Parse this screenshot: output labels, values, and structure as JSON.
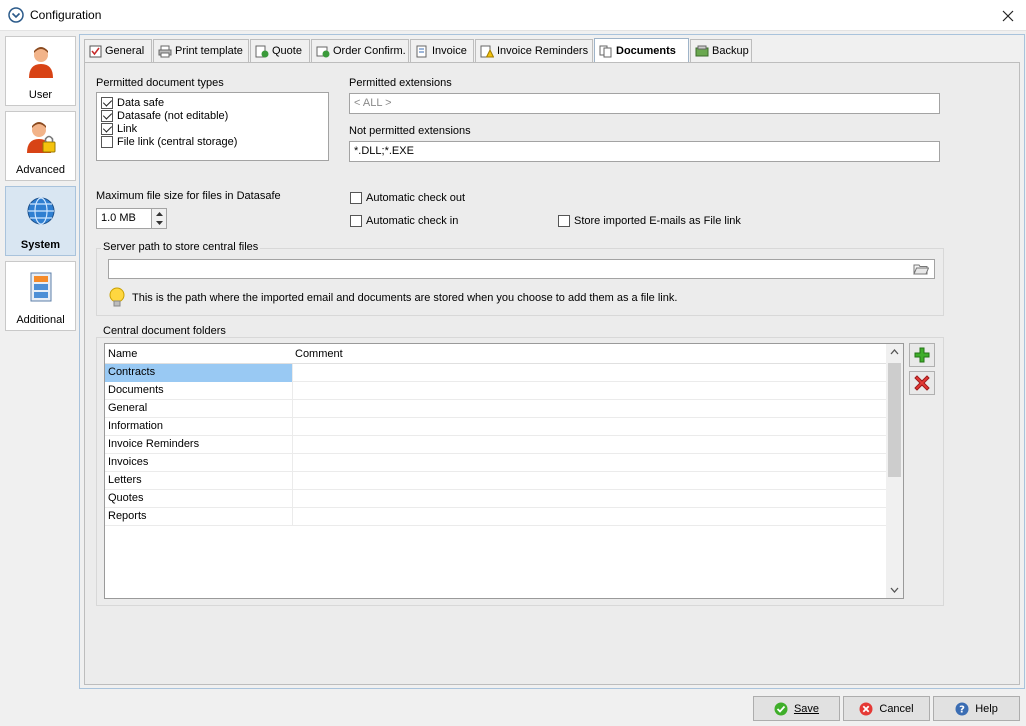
{
  "window": {
    "title": "Configuration"
  },
  "nav": [
    {
      "label": "User"
    },
    {
      "label": "Advanced"
    },
    {
      "label": "System"
    },
    {
      "label": "Additional"
    }
  ],
  "tabs": [
    {
      "label": "General"
    },
    {
      "label": "Print template"
    },
    {
      "label": "Quote"
    },
    {
      "label": "Order Confirm."
    },
    {
      "label": "Invoice"
    },
    {
      "label": "Invoice Reminders"
    },
    {
      "label": "Documents"
    },
    {
      "label": "Backup"
    }
  ],
  "documents": {
    "permitted_types_label": "Permitted document types",
    "types": [
      {
        "label": "Data safe",
        "checked": true
      },
      {
        "label": "Datasafe (not editable)",
        "checked": true
      },
      {
        "label": "Link",
        "checked": true
      },
      {
        "label": "File link (central storage)",
        "checked": false
      }
    ],
    "permitted_ext_label": "Permitted extensions",
    "permitted_ext_placeholder": "< ALL >",
    "not_permitted_ext_label": "Not permitted extensions",
    "not_permitted_ext_value": "*.DLL;*.EXE",
    "max_size_label": "Maximum file size for files in Datasafe",
    "max_size_value": "1.0 MB",
    "auto_checkout_label": "Automatic check out",
    "auto_checkin_label": "Automatic check in",
    "store_emails_label": "Store imported E-mails as File link",
    "server_path_label": "Server path to store central files",
    "server_path_value": "",
    "server_path_hint": "This is the path where the imported email and documents are stored when you choose to add them as a file link.",
    "folders_label": "Central document folders",
    "folders_columns": [
      "Name",
      "Comment"
    ],
    "folders": [
      {
        "name": "Contracts",
        "comment": ""
      },
      {
        "name": "Documents",
        "comment": ""
      },
      {
        "name": "General",
        "comment": ""
      },
      {
        "name": "Information",
        "comment": ""
      },
      {
        "name": "Invoice Reminders",
        "comment": ""
      },
      {
        "name": "Invoices",
        "comment": ""
      },
      {
        "name": "Letters",
        "comment": ""
      },
      {
        "name": "Quotes",
        "comment": ""
      },
      {
        "name": "Reports",
        "comment": ""
      }
    ]
  },
  "buttons": {
    "save": "Save",
    "cancel": "Cancel",
    "help": "Help"
  },
  "colors": {
    "selection": "#99c9f3",
    "nav_selected": "#d9e6f2"
  }
}
